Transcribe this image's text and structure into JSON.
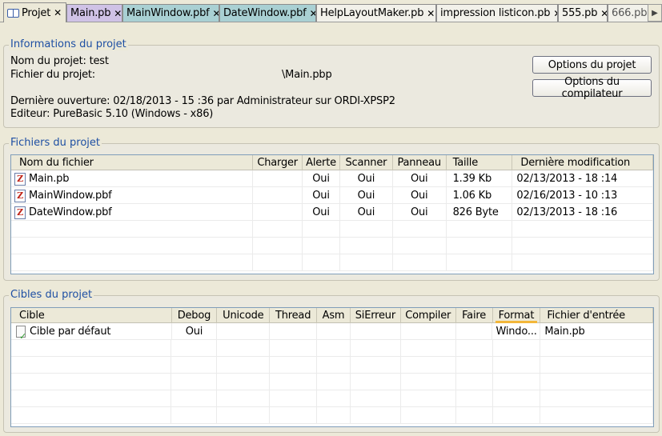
{
  "tabs": [
    {
      "label": "Projet",
      "active": true,
      "color": "#ece9d8"
    },
    {
      "label": "Main.pb",
      "color": "#cfc2e6"
    },
    {
      "label": "MainWindow.pbf",
      "color": "#a9d0d3"
    },
    {
      "label": "DateWindow.pbf",
      "color": "#a9d0d3"
    },
    {
      "label": "HelpLayoutMaker.pb",
      "color": "#f2f1ea"
    },
    {
      "label": "impression listicon.pb",
      "color": "#f2f1ea"
    },
    {
      "label": "555.pb",
      "color": "#f2f1ea"
    },
    {
      "label": "666.pb",
      "color": "#f2f1ea"
    }
  ],
  "tab_close_glyph": "✕",
  "project_info": {
    "title": "Informations du projet",
    "project_name": "Nom du projet: test",
    "project_file_label": "Fichier du projet:",
    "project_file_value": "\\Main.pbp",
    "last_opened": "Dernière ouverture: 02/18/2013 - 15 :36 par Administrateur sur ORDI-XPSP2",
    "editor": "Editeur: PureBasic 5.10 (Windows - x86)",
    "project_options_button": "Options du projet",
    "compiler_options_button": "Options du compilateur"
  },
  "files": {
    "title": "Fichiers du projet",
    "columns": [
      "Nom du fichier",
      "Charger",
      "Alerte",
      "Scanner",
      "Panneau",
      "Taille",
      "Dernière modification"
    ],
    "rows": [
      {
        "name": "Main.pb",
        "load": "",
        "alert": "Oui",
        "scan": "Oui",
        "panel": "Oui",
        "size": "1.39 Kb",
        "modified": "02/13/2013 - 18 :14"
      },
      {
        "name": "MainWindow.pbf",
        "load": "",
        "alert": "Oui",
        "scan": "Oui",
        "panel": "Oui",
        "size": "1.06 Kb",
        "modified": "02/16/2013 - 10 :13"
      },
      {
        "name": "DateWindow.pbf",
        "load": "",
        "alert": "Oui",
        "scan": "Oui",
        "panel": "Oui",
        "size": "826 Byte",
        "modified": "02/13/2013 - 18 :16"
      }
    ]
  },
  "targets": {
    "title": "Cibles du projet",
    "columns": [
      "Cible",
      "Debog",
      "Unicode",
      "Thread",
      "Asm",
      "SiErreur",
      "Compiler",
      "Faire",
      "Format",
      "Fichier d'entrée"
    ],
    "sorted_column": "Format",
    "rows": [
      {
        "name": "Cible par défaut",
        "debug": "Oui",
        "unicode": "",
        "thread": "",
        "asm": "",
        "onerror": "",
        "compile": "",
        "make": "",
        "format": "Windo...",
        "input": "Main.pb"
      }
    ]
  }
}
